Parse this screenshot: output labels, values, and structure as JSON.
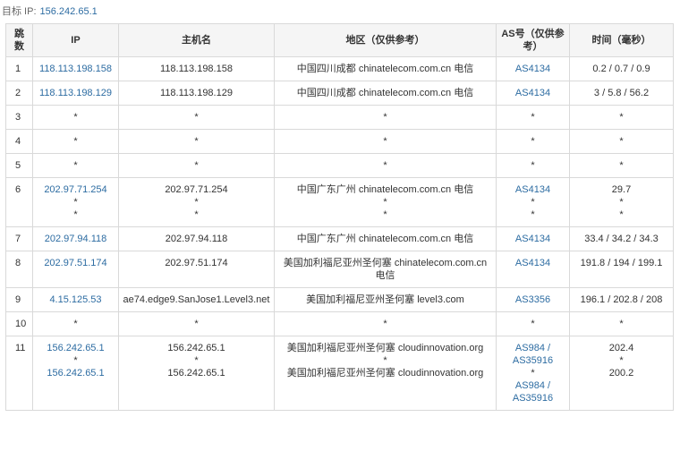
{
  "header": {
    "target_label": "目标 IP:",
    "target_ip": "156.242.65.1"
  },
  "columns": {
    "hop": "跳数",
    "ip": "IP",
    "host": "主机名",
    "region": "地区（仅供参考）",
    "as": "AS号（仅供参考）",
    "time": "时间（毫秒）"
  },
  "rows": [
    {
      "hop": "1",
      "ip": [
        "118.113.198.158"
      ],
      "host": [
        "118.113.198.158"
      ],
      "region": [
        "中国四川成都 chinatelecom.com.cn 电信"
      ],
      "as": [
        "AS4134"
      ],
      "time": [
        "0.2 / 0.7 / 0.9"
      ]
    },
    {
      "hop": "2",
      "ip": [
        "118.113.198.129"
      ],
      "host": [
        "118.113.198.129"
      ],
      "region": [
        "中国四川成都 chinatelecom.com.cn 电信"
      ],
      "as": [
        "AS4134"
      ],
      "time": [
        "3 / 5.8 / 56.2"
      ]
    },
    {
      "hop": "3",
      "ip": [
        "*"
      ],
      "host": [
        "*"
      ],
      "region": [
        "*"
      ],
      "as": [
        "*"
      ],
      "time": [
        "*"
      ]
    },
    {
      "hop": "4",
      "ip": [
        "*"
      ],
      "host": [
        "*"
      ],
      "region": [
        "*"
      ],
      "as": [
        "*"
      ],
      "time": [
        "*"
      ]
    },
    {
      "hop": "5",
      "ip": [
        "*"
      ],
      "host": [
        "*"
      ],
      "region": [
        "*"
      ],
      "as": [
        "*"
      ],
      "time": [
        "*"
      ]
    },
    {
      "hop": "6",
      "ip": [
        "202.97.71.254",
        "*",
        "*"
      ],
      "host": [
        "202.97.71.254",
        "*",
        "*"
      ],
      "region": [
        "中国广东广州 chinatelecom.com.cn 电信",
        "*",
        "*"
      ],
      "as": [
        "AS4134",
        "*",
        "*"
      ],
      "time": [
        "29.7",
        "*",
        "*"
      ]
    },
    {
      "hop": "7",
      "ip": [
        "202.97.94.118"
      ],
      "host": [
        "202.97.94.118"
      ],
      "region": [
        "中国广东广州 chinatelecom.com.cn 电信"
      ],
      "as": [
        "AS4134"
      ],
      "time": [
        "33.4 / 34.2 / 34.3"
      ]
    },
    {
      "hop": "8",
      "ip": [
        "202.97.51.174"
      ],
      "host": [
        "202.97.51.174"
      ],
      "region": [
        "美国加利福尼亚州圣何塞 chinatelecom.com.cn 电信"
      ],
      "as": [
        "AS4134"
      ],
      "time": [
        "191.8 / 194 / 199.1"
      ]
    },
    {
      "hop": "9",
      "ip": [
        "4.15.125.53"
      ],
      "host": [
        "ae74.edge9.SanJose1.Level3.net"
      ],
      "region": [
        "美国加利福尼亚州圣何塞 level3.com"
      ],
      "as": [
        "AS3356"
      ],
      "time": [
        "196.1 / 202.8 / 208"
      ]
    },
    {
      "hop": "10",
      "ip": [
        "*"
      ],
      "host": [
        "*"
      ],
      "region": [
        "*"
      ],
      "as": [
        "*"
      ],
      "time": [
        "*"
      ]
    },
    {
      "hop": "11",
      "ip": [
        "156.242.65.1",
        "*",
        "156.242.65.1"
      ],
      "host": [
        "156.242.65.1",
        "*",
        "156.242.65.1"
      ],
      "region": [
        "美国加利福尼亚州圣何塞 cloudinnovation.org",
        "*",
        "美国加利福尼亚州圣何塞 cloudinnovation.org"
      ],
      "as": [
        "AS984 / AS35916",
        "*",
        "AS984 / AS35916"
      ],
      "time": [
        "202.4",
        "*",
        "200.2"
      ]
    }
  ]
}
